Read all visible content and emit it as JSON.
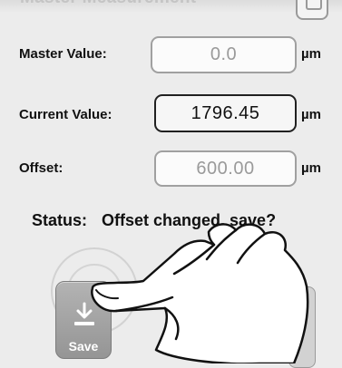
{
  "header": {
    "clipped_title": "Master Measurement"
  },
  "fields": [
    {
      "label": "Master Value:",
      "value": "0.0",
      "unit": "µm"
    },
    {
      "label": "Current Value:",
      "value": "1796.45",
      "unit": "µm"
    },
    {
      "label": "Offset:",
      "value": "600.00",
      "unit": "µm"
    }
  ],
  "status": {
    "label": "Status:",
    "message": "Offset changed, save?"
  },
  "save_button": {
    "label": "Save"
  },
  "icons": {
    "save": "download-arrow-icon",
    "pointer": "hand-pointer-icon",
    "corner": "panel-icon"
  },
  "colors": {
    "background": "#ececec",
    "save_button": "#a3a3a3",
    "field_border_active": "#202020",
    "field_text_readonly": "#9a9a9a"
  }
}
